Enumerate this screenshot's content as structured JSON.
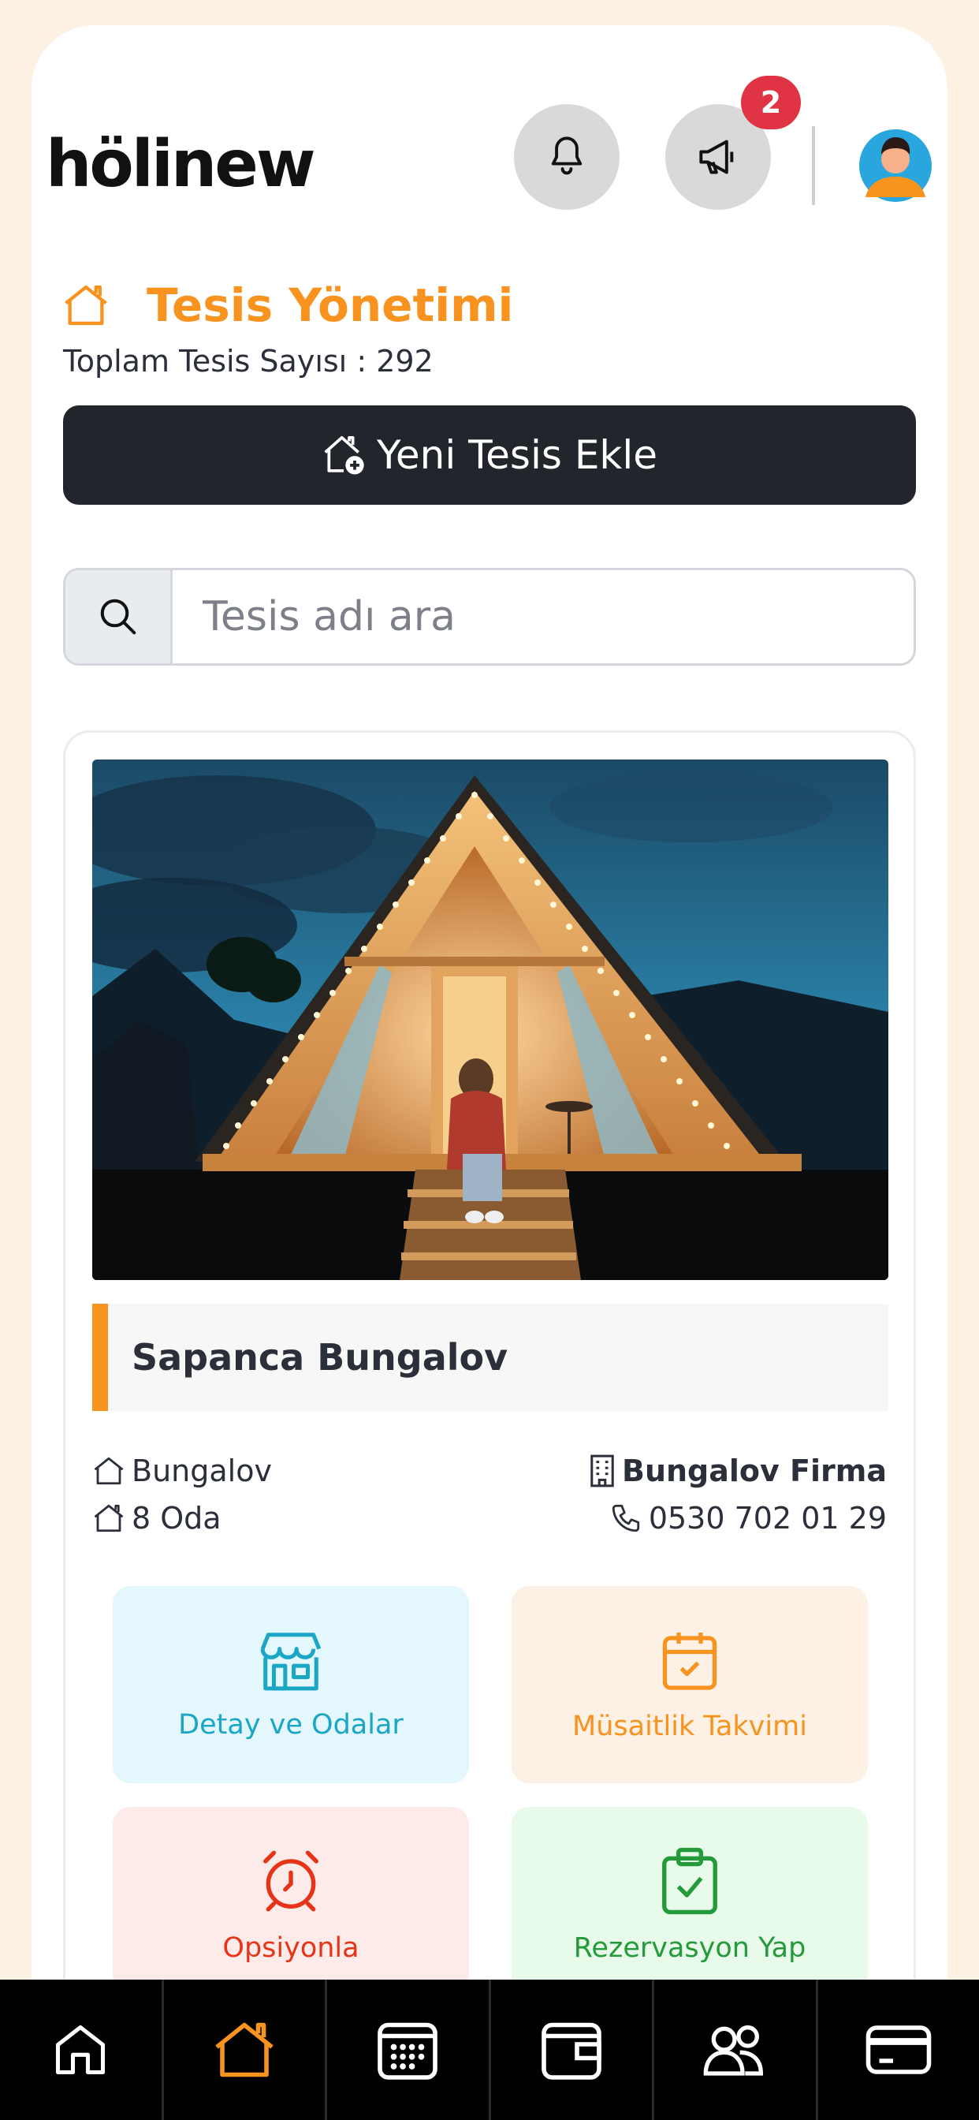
{
  "app": {
    "logo_text": "hölinew"
  },
  "header": {
    "notifications_badge": "2"
  },
  "page": {
    "title": "Tesis Yönetimi",
    "total_label": "Toplam Tesis Sayısı : 292",
    "add_button": "Yeni Tesis Ekle",
    "search_placeholder": "Tesis adı ara"
  },
  "facility": {
    "name": "Sapanca Bungalov",
    "type": "Bungalov",
    "rooms": "8 Oda",
    "company": "Bungalov Firma",
    "phone": "0530 702 01 29"
  },
  "actions": [
    {
      "label": "Detay ve Odalar",
      "icon": "store-icon"
    },
    {
      "label": "Müsaitlik Takvimi",
      "icon": "calendar-check-icon"
    },
    {
      "label": "Opsiyonla",
      "icon": "alarm-clock-icon"
    },
    {
      "label": "Rezervasyon Yap",
      "icon": "clipboard-check-icon"
    }
  ],
  "nav": [
    "home-icon",
    "facility-home-icon",
    "grid-calendar-icon",
    "wallet-icon",
    "users-icon",
    "credit-card-icon"
  ],
  "colors": {
    "accent": "#f7931e",
    "dark": "#22252b",
    "badge": "#e03445",
    "background": "#fdf1e3"
  }
}
